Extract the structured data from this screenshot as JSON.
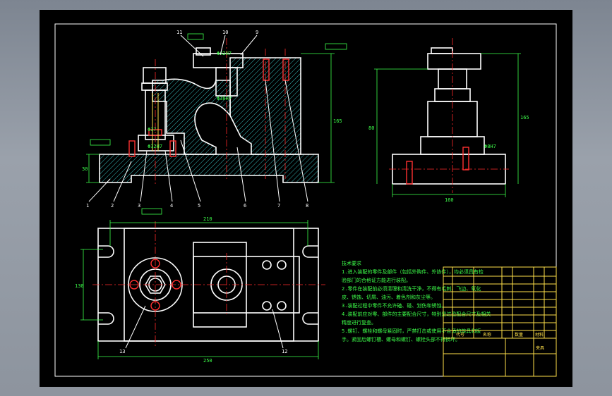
{
  "views": {
    "front": {
      "part_numbers": [
        "1",
        "2",
        "3",
        "4",
        "5",
        "6",
        "7",
        "8"
      ],
      "top_labels": [
        "11",
        "10",
        "9"
      ],
      "dims": {
        "left_height": "30",
        "right_height": "165",
        "phi_top": "Φ42H7",
        "phi_mid": "Φ38H7",
        "phi_bolt": "Φ37",
        "phi_bottom": "Φ32H7"
      }
    },
    "side": {
      "dims": {
        "width": "160",
        "height_left": "80",
        "height_right": "165",
        "small": "Φ8H7"
      }
    },
    "top": {
      "dims": {
        "top_width": "210",
        "bottom_width": "250",
        "left_height": "130"
      },
      "part_numbers": [
        "13",
        "12"
      ]
    }
  },
  "notes": {
    "title": "技术要求",
    "lines": [
      "1.进入装配的零件及部件（包括外购件、外协件），均必须具有检",
      "验部门的合格证方能进行装配。",
      "2.零件在装配前必须清理和清洗干净，不得有毛刺、飞边、氧化",
      "皮、锈蚀、切屑、油污、着色剂和灰尘等。",
      "3.装配过程中零件不允许磕、碰、划伤和锈蚀。",
      "4.装配前应对零、部件的主要配合尺寸，特别是过盈配合尺寸及相关",
      "精度进行复查。",
      "5.螺钉、螺栓和螺母紧固时，严禁打击或使用不合适的旋具和扳",
      "手。紧固后螺钉槽、螺母和螺钉、螺栓头部不得损坏。"
    ]
  },
  "title_block": {
    "header": {
      "code": "代号",
      "name": "名称",
      "qty": "数量",
      "material": "材料"
    },
    "main_title": "夹具"
  }
}
